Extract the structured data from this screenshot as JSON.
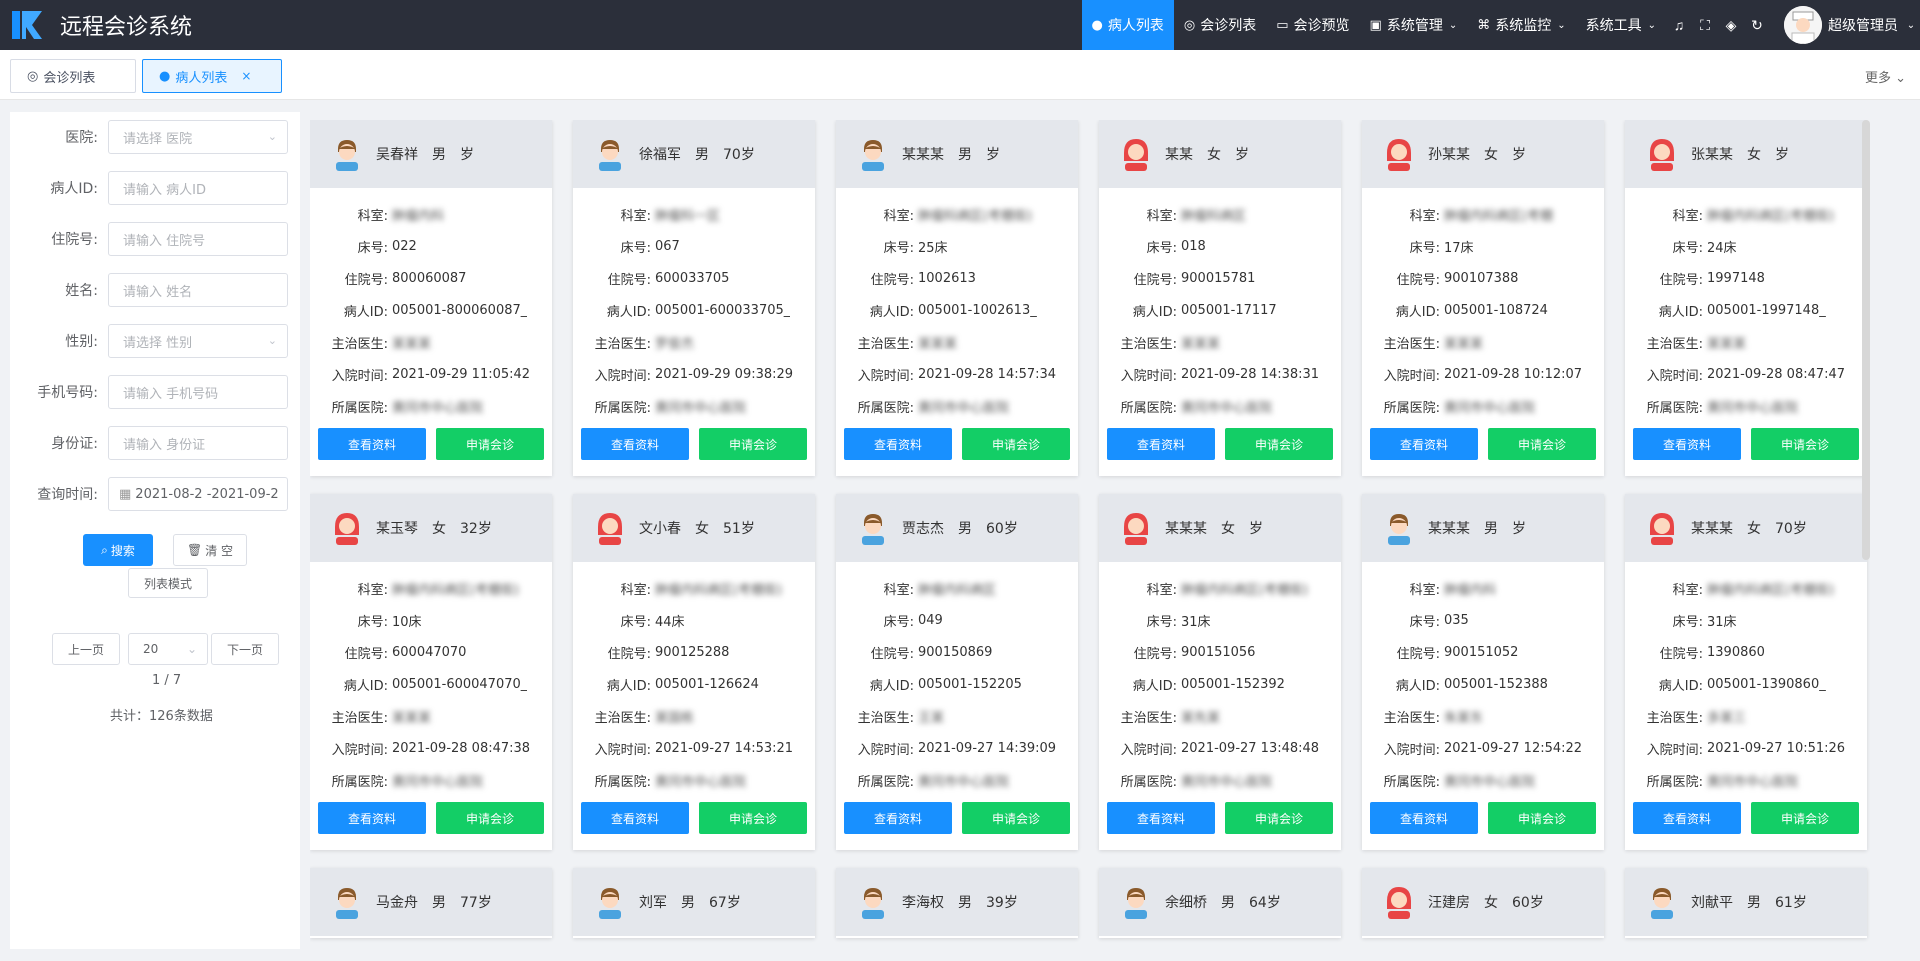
{
  "app": {
    "title": "远程会诊系统"
  },
  "nav": {
    "items": [
      {
        "label": "病人列表",
        "active": true
      },
      {
        "label": "会诊列表"
      },
      {
        "label": "会诊预览"
      },
      {
        "label": "系统管理"
      },
      {
        "label": "系统监控"
      },
      {
        "label": "系统工具"
      }
    ],
    "user_name": "超级管理员"
  },
  "tabs": {
    "items": [
      {
        "label": "会诊列表"
      },
      {
        "label": "病人列表",
        "active": true
      }
    ],
    "more_label": "更多"
  },
  "filters": {
    "hospital": {
      "label": "医院:",
      "placeholder": "请选择 医院"
    },
    "patient_id": {
      "label": "病人ID:",
      "placeholder": "请输入 病人ID"
    },
    "inpatient_no": {
      "label": "住院号:",
      "placeholder": "请输入 住院号"
    },
    "name": {
      "label": "姓名:",
      "placeholder": "请输入 姓名"
    },
    "gender": {
      "label": "性别:",
      "placeholder": "请选择 性别"
    },
    "phone": {
      "label": "手机号码:",
      "placeholder": "请输入 手机号码"
    },
    "id_card": {
      "label": "身份证:",
      "placeholder": "请输入 身份证"
    },
    "query_time": {
      "label": "查询时间:",
      "value": "2021-08-2 -2021-09-2"
    },
    "search_label": "搜索",
    "clear_label": "清 空",
    "list_mode_label": "列表模式",
    "prev_label": "上一页",
    "page_size": "20",
    "next_label": "下一页",
    "page_indicator": "1 / 7",
    "total_label": "共计：126条数据"
  },
  "card_labels": {
    "dept": "科室:",
    "bed": "床号:",
    "inpatient_no": "住院号:",
    "patient_id": "病人ID:",
    "doctor": "主治医生:",
    "admit_time": "入院时间:",
    "hospital": "所属医院:",
    "view_btn": "查看资料",
    "apply_btn": "申请会诊"
  },
  "patients": [
    {
      "name": "吴春祥",
      "gender": "男",
      "age": "岁",
      "sex": "m",
      "dept": "肿瘤内科",
      "bed": "022",
      "inpatient_no": "800060087",
      "patient_id": "005001-800060087_",
      "doctor": "某某某",
      "admit_time": "2021-09-29 11:05:42",
      "hospital": "黄冈市中心医院"
    },
    {
      "name": "徐福军",
      "gender": "男",
      "age": "70岁",
      "sex": "m",
      "dept": "肿瘤科一区",
      "bed": "067",
      "inpatient_no": "600033705",
      "patient_id": "005001-600033705_",
      "doctor": "罗俊杰",
      "admit_time": "2021-09-29 09:38:29",
      "hospital": "黄冈市中心医院"
    },
    {
      "name": "某某某",
      "gender": "男",
      "age": "岁",
      "sex": "m",
      "dept": "肿瘤科病区(考棚街)",
      "bed": "25床",
      "inpatient_no": "1002613",
      "patient_id": "005001-1002613_",
      "doctor": "某某某",
      "admit_time": "2021-09-28 14:57:34",
      "hospital": "黄冈市中心医院"
    },
    {
      "name": "某某",
      "gender": "女",
      "age": "岁",
      "sex": "f",
      "dept": "肿瘤科病区",
      "bed": "018",
      "inpatient_no": "900015781",
      "patient_id": "005001-17117",
      "doctor": "某某某",
      "admit_time": "2021-09-28 14:38:31",
      "hospital": "黄冈市中心医院"
    },
    {
      "name": "孙某某",
      "gender": "女",
      "age": "岁",
      "sex": "f",
      "dept": "肿瘤内科病区(考棚",
      "bed": "17床",
      "inpatient_no": "900107388",
      "patient_id": "005001-108724",
      "doctor": "某某某",
      "admit_time": "2021-09-28 10:12:07",
      "hospital": "黄冈市中心医院"
    },
    {
      "name": "张某某",
      "gender": "女",
      "age": "岁",
      "sex": "f",
      "dept": "肿瘤内科病区(考棚街)",
      "bed": "24床",
      "inpatient_no": "1997148",
      "patient_id": "005001-1997148_",
      "doctor": "某某某",
      "admit_time": "2021-09-28 08:47:47",
      "hospital": "黄冈市中心医院"
    },
    {
      "name": "某玉琴",
      "gender": "女",
      "age": "32岁",
      "sex": "f",
      "dept": "肿瘤内科病区(考棚街)",
      "bed": "10床",
      "inpatient_no": "600047070",
      "patient_id": "005001-600047070_",
      "doctor": "某某某",
      "admit_time": "2021-09-28 08:47:38",
      "hospital": "黄冈市中心医院"
    },
    {
      "name": "文小春",
      "gender": "女",
      "age": "51岁",
      "sex": "f",
      "dept": "肿瘤内科病区(考棚街)",
      "bed": "44床",
      "inpatient_no": "900125288",
      "patient_id": "005001-126624",
      "doctor": "某国栋",
      "admit_time": "2021-09-27 14:53:21",
      "hospital": "黄冈市中心医院"
    },
    {
      "name": "贾志杰",
      "gender": "男",
      "age": "60岁",
      "sex": "m",
      "dept": "肿瘤内科病区",
      "bed": "049",
      "inpatient_no": "900150869",
      "patient_id": "005001-152205",
      "doctor": "王某",
      "admit_time": "2021-09-27 14:39:09",
      "hospital": "黄冈市中心医院"
    },
    {
      "name": "某某某",
      "gender": "女",
      "age": "岁",
      "sex": "f",
      "dept": "肿瘤内科病区(考棚街)",
      "bed": "31床",
      "inpatient_no": "900151056",
      "patient_id": "005001-152392",
      "doctor": "某先某",
      "admit_time": "2021-09-27 13:48:48",
      "hospital": "黄冈市中心医院"
    },
    {
      "name": "某某某",
      "gender": "男",
      "age": "岁",
      "sex": "m",
      "dept": "肿瘤内科",
      "bed": "035",
      "inpatient_no": "900151052",
      "patient_id": "005001-152388",
      "doctor": "朱某东",
      "admit_time": "2021-09-27 12:54:22",
      "hospital": "黄冈市中心医院"
    },
    {
      "name": "某某某",
      "gender": "女",
      "age": "70岁",
      "sex": "f",
      "dept": "肿瘤内科病区(考棚街)",
      "bed": "31床",
      "inpatient_no": "1390860",
      "patient_id": "005001-1390860_",
      "doctor": "多某三",
      "admit_time": "2021-09-27 10:51:26",
      "hospital": "黄冈市中心医院"
    },
    {
      "name": "马金舟",
      "gender": "男",
      "age": "77岁",
      "sex": "m"
    },
    {
      "name": "刘军",
      "gender": "男",
      "age": "67岁",
      "sex": "m"
    },
    {
      "name": "李海权",
      "gender": "男",
      "age": "39岁",
      "sex": "m"
    },
    {
      "name": "余细桥",
      "gender": "男",
      "age": "64岁",
      "sex": "m"
    },
    {
      "name": "汪建房",
      "gender": "女",
      "age": "60岁",
      "sex": "f"
    },
    {
      "name": "刘献平",
      "gender": "男",
      "age": "61岁",
      "sex": "m"
    }
  ]
}
